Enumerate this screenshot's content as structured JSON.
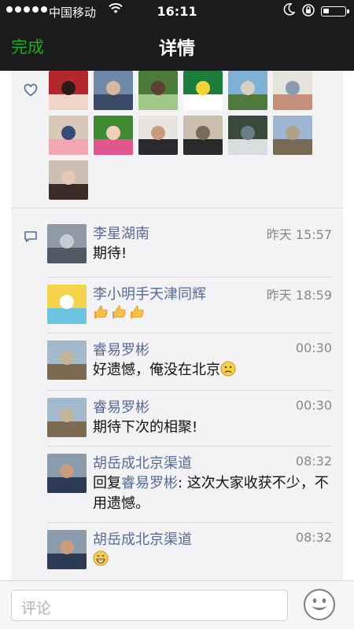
{
  "status_bar": {
    "carrier": "中国移动",
    "time": "16:11",
    "battery_level": 0.25
  },
  "nav": {
    "done_label": "完成",
    "title": "详情"
  },
  "likers": [
    {
      "name": "liker-1",
      "colors": [
        "#b3262b",
        "#f1d6c8",
        "#2b1b18"
      ]
    },
    {
      "name": "liker-2",
      "colors": [
        "#6f8aa8",
        "#3a4a66",
        "#d8b89e"
      ]
    },
    {
      "name": "liker-3",
      "colors": [
        "#4b7a3a",
        "#9fc78a",
        "#5d4030"
      ]
    },
    {
      "name": "liker-4",
      "colors": [
        "#1d7d3a",
        "#ffffff",
        "#f0d43a"
      ]
    },
    {
      "name": "liker-5",
      "colors": [
        "#7fb0d6",
        "#4e7a3e",
        "#d6d0c2"
      ]
    },
    {
      "name": "liker-6",
      "colors": [
        "#e6e2dc",
        "#c68f7a",
        "#8a9bb0"
      ]
    },
    {
      "name": "liker-7",
      "colors": [
        "#d9c9b8",
        "#f2a7b0",
        "#394a7a"
      ]
    },
    {
      "name": "liker-8",
      "colors": [
        "#3f8a33",
        "#e0568f",
        "#f2d0c0"
      ]
    },
    {
      "name": "liker-9",
      "colors": [
        "#e8e4df",
        "#2a2a2e",
        "#c99b7e"
      ]
    },
    {
      "name": "liker-10",
      "colors": [
        "#c9bfae",
        "#2a2a2a",
        "#7a6a58"
      ]
    },
    {
      "name": "liker-11",
      "colors": [
        "#3a4a3a",
        "#d9dde0",
        "#6b7d88"
      ]
    },
    {
      "name": "liker-12",
      "colors": [
        "#9db7d3",
        "#7a6a55",
        "#b0a08a"
      ]
    },
    {
      "name": "liker-13",
      "colors": [
        "#cdbfb4",
        "#3b2c28",
        "#e7c8b8"
      ]
    }
  ],
  "comments": [
    {
      "name": "李星湖南",
      "time": "昨天 15:57",
      "text": "期待!",
      "avatar_colors": [
        "#8e9aa6",
        "#4f5a64",
        "#c5cbd0"
      ]
    },
    {
      "name": "李小明手天津同辉",
      "time": "昨天 18:59",
      "text": "",
      "thumbs": 3,
      "avatar_colors": [
        "#f3d44a",
        "#6cc3e0",
        "#ffffff"
      ]
    },
    {
      "name": "睿易罗彬",
      "time": "00:30",
      "text": "好遗憾，俺没在北京",
      "avatar_colors": [
        "#a3b9cc",
        "#7c6a52",
        "#c4b49a"
      ]
    },
    {
      "name": "睿易罗彬",
      "time": "00:30",
      "text": "期待下次的相聚!",
      "avatar_colors": [
        "#a3b9cc",
        "#7c6a52",
        "#c4b49a"
      ]
    },
    {
      "name": "胡岳成北京渠道",
      "time": "08:32",
      "reply_prefix": "回复",
      "reply_to": "睿易罗彬",
      "reply_text": ": 这次大家收获不少，不用遗憾。",
      "avatar_colors": [
        "#8a9cab",
        "#2c3a55",
        "#c99b7e"
      ]
    },
    {
      "name": "胡岳成北京渠道",
      "time": "08:32",
      "text": "",
      "grin": true,
      "avatar_colors": [
        "#8a9cab",
        "#2c3a55",
        "#c99b7e"
      ]
    }
  ],
  "bottom": {
    "comment_placeholder": "评论"
  },
  "colors": {
    "accent_green": "#1aad19",
    "link_blue": "#576b95",
    "bar_dark": "#1b1b1d"
  },
  "icons": {
    "like": "heart-outline-icon",
    "comment": "comment-bubble-icon",
    "emoji": "smiley-face-icon"
  }
}
